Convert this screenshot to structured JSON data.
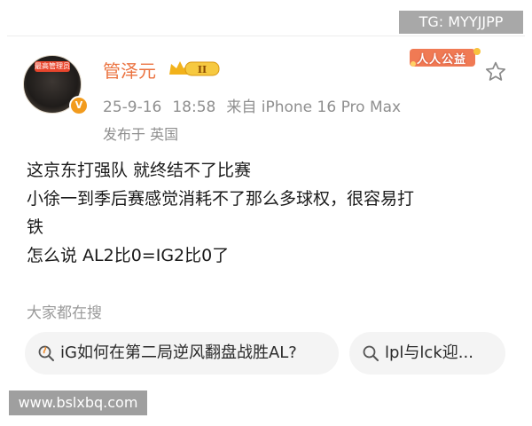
{
  "watermark": {
    "top": "TG: MYYJJPP",
    "bottom": "www.bslxbq.com"
  },
  "user": {
    "name": "管泽元",
    "avatar_label": "最高管理员",
    "verified_badge": "V",
    "level_badge": "II",
    "member_tag": "人人公益"
  },
  "meta": {
    "date": "25-9-16",
    "time": "18:58",
    "source": "来自 iPhone 16 Pro Max",
    "location": "发布于 英国"
  },
  "post": {
    "lines": [
      "这京东打强队 就终结不了比赛",
      "小徐一到季后赛感觉消耗不了那么多球权，很容易打",
      "铁",
      "怎么说 AL2比0=IG2比0了"
    ]
  },
  "search": {
    "heading": "大家都在搜",
    "chips": [
      "iG如何在第二局逆风翻盘战胜AL?",
      "lpl与lck迎..."
    ]
  },
  "icons": {
    "star": "star-icon",
    "search": "search-icon",
    "hot_search": "hot-search-icon"
  },
  "colors": {
    "username": "#eb7340",
    "meta": "#8f8f8f",
    "chip_bg": "#f4f4f4"
  }
}
